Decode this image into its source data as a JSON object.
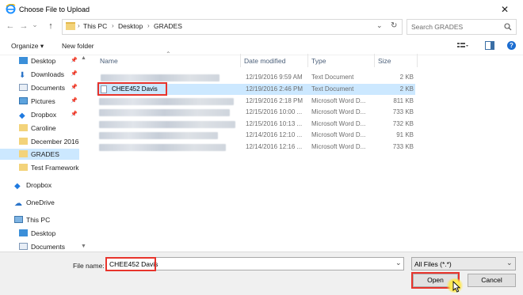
{
  "window": {
    "title": "Choose File to Upload",
    "close_glyph": "✕"
  },
  "nav": {
    "back": "←",
    "forward": "→",
    "history": "⌄",
    "up": "↑",
    "refresh": "↻",
    "dropdown": "⌄"
  },
  "breadcrumb": [
    "This PC",
    "Desktop",
    "GRADES"
  ],
  "search": {
    "placeholder": "Search GRADES"
  },
  "toolbar": {
    "organize": "Organize ▾",
    "new_folder": "New folder"
  },
  "sidebar": {
    "items": [
      {
        "label": "Desktop",
        "icon": "desktop-icon",
        "pinned": true
      },
      {
        "label": "Downloads",
        "icon": "download-icon",
        "pinned": true
      },
      {
        "label": "Documents",
        "icon": "documents-icon",
        "pinned": true
      },
      {
        "label": "Pictures",
        "icon": "pictures-icon",
        "pinned": true
      },
      {
        "label": "Dropbox",
        "icon": "dropbox-icon",
        "pinned": true
      },
      {
        "label": "Caroline",
        "icon": "folder-icon",
        "pinned": false
      },
      {
        "label": "December 2016",
        "icon": "folder-icon",
        "pinned": false
      },
      {
        "label": "GRADES",
        "icon": "folder-icon",
        "pinned": false,
        "selected": true
      },
      {
        "label": "Test Framework",
        "icon": "folder-icon",
        "pinned": false
      },
      {
        "label": "Dropbox",
        "icon": "dropbox-icon",
        "pinned": false
      },
      {
        "label": "OneDrive",
        "icon": "onedrive-icon",
        "pinned": false
      },
      {
        "label": "This PC",
        "icon": "computer-icon",
        "pinned": false
      },
      {
        "label": "Desktop",
        "icon": "desktop-icon",
        "pinned": false
      },
      {
        "label": "Documents",
        "icon": "documents-icon",
        "pinned": false
      }
    ]
  },
  "columns": {
    "name": "Name",
    "date": "Date modified",
    "type": "Type",
    "size": "Size"
  },
  "files": [
    {
      "name": "",
      "date": "12/19/2016 9:59 AM",
      "type": "Text Document",
      "size": "2 KB"
    },
    {
      "name": "CHEE452 Davis",
      "date": "12/19/2016 2:46 PM",
      "type": "Text Document",
      "size": "2 KB",
      "selected": true
    },
    {
      "name": "",
      "date": "12/19/2016 2:18 PM",
      "type": "Microsoft Word D...",
      "size": "811 KB"
    },
    {
      "name": "",
      "date": "12/15/2016 10:00 ...",
      "type": "Microsoft Word D...",
      "size": "733 KB"
    },
    {
      "name": "",
      "date": "12/15/2016 10:13 ...",
      "type": "Microsoft Word D...",
      "size": "732 KB"
    },
    {
      "name": "",
      "date": "12/14/2016 12:10 ...",
      "type": "Microsoft Word D...",
      "size": "91 KB"
    },
    {
      "name": "",
      "date": "12/14/2016 12:16 ...",
      "type": "Microsoft Word D...",
      "size": "733 KB"
    }
  ],
  "footer": {
    "filename_label": "File name:",
    "filename_value": "CHEE452 Davis",
    "filter_value": "All Files (*.*)",
    "open_label": "Open",
    "cancel_label": "Cancel"
  },
  "colors": {
    "selection": "#cce8ff",
    "highlight": "#e8342c"
  }
}
